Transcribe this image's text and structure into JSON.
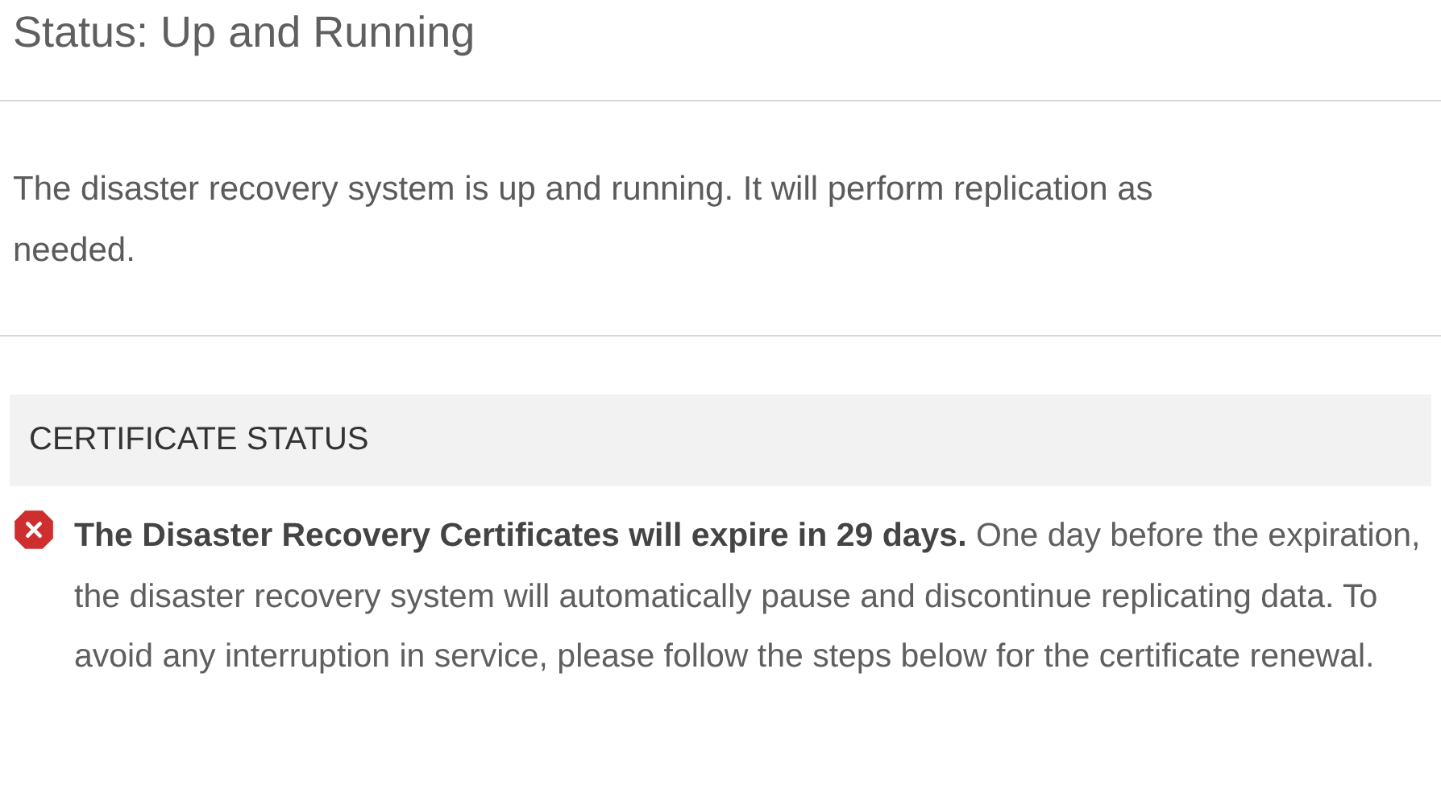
{
  "status_title": "Status: Up and Running",
  "description": "The disaster recovery system is up and running. It will perform replication as needed.",
  "certificate_status": {
    "heading": "CERTIFICATE STATUS",
    "alert": {
      "kind": "error",
      "message": "**The Disaster Recovery Certificates will expire in 29 days.** One day before the expiration, the disaster recovery system will automatically pause and discontinue replicating data. To avoid any interruption in service, please follow the steps below for the certificate renewal."
    }
  }
}
